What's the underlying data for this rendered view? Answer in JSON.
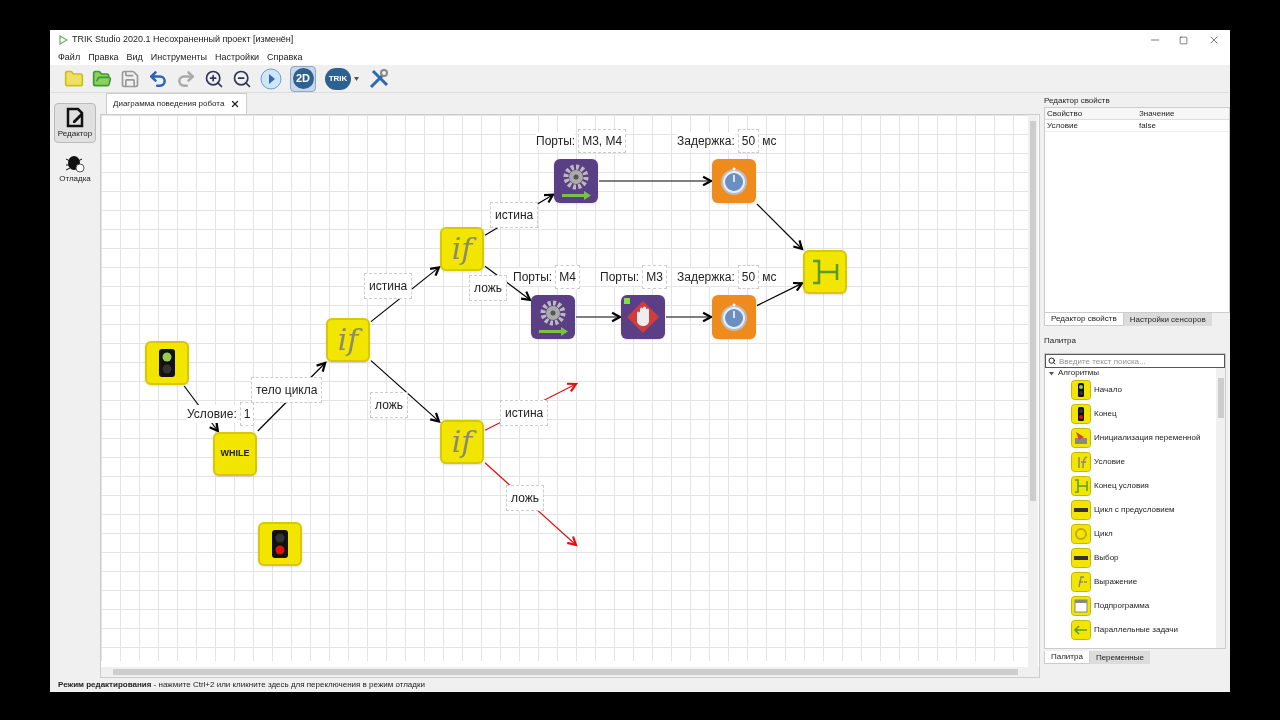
{
  "window": {
    "title": "TRIK Studio 2020.1 Несохраненный проект [изменён]"
  },
  "menu": [
    "Файл",
    "Правка",
    "Вид",
    "Инструменты",
    "Настройки",
    "Справка"
  ],
  "toolbar": [
    {
      "kind": "new"
    },
    {
      "kind": "open"
    },
    {
      "kind": "save"
    },
    {
      "kind": "undo"
    },
    {
      "kind": "redo"
    },
    {
      "kind": "zoom-in"
    },
    {
      "kind": "zoom-out"
    },
    {
      "kind": "run"
    },
    {
      "kind": "model",
      "label": "2D",
      "selected": true
    },
    {
      "kind": "robot",
      "label": "TRIK",
      "selected": false
    },
    {
      "kind": "tools"
    }
  ],
  "modes": [
    {
      "label": "Редактор",
      "kind": "editor",
      "selected": true
    },
    {
      "label": "Отладка",
      "kind": "debug",
      "selected": false
    }
  ],
  "document_tab": {
    "label": "Диаграмма поведения робота"
  },
  "diagram": {
    "nodes": [
      {
        "kind": "start"
      },
      {
        "kind": "while",
        "text": "WHILE",
        "param_label": "Условие:",
        "param_value": "1"
      },
      {
        "kind": "if",
        "text": "if"
      },
      {
        "kind": "if",
        "text": "if"
      },
      {
        "kind": "if",
        "text": "if"
      },
      {
        "kind": "motor",
        "param_label": "Порты:",
        "param_value": "M3, M4"
      },
      {
        "kind": "timer",
        "param_label": "Задержка:",
        "param_value": "50",
        "unit": "мс"
      },
      {
        "kind": "motor",
        "param_label": "Порты:",
        "param_value": "M4"
      },
      {
        "kind": "stop",
        "param_label": "Порты:",
        "param_value": "M3"
      },
      {
        "kind": "timer",
        "param_label": "Задержка:",
        "param_value": "50",
        "unit": "мс"
      },
      {
        "kind": "endif"
      },
      {
        "kind": "end"
      }
    ],
    "edges": [
      {
        "kind": "link"
      },
      {
        "kind": "link",
        "label": "тело цикла"
      },
      {
        "kind": "link",
        "label": "истина"
      },
      {
        "kind": "link",
        "label": "ложь"
      },
      {
        "kind": "link",
        "label": "истина"
      },
      {
        "kind": "link",
        "label": "ложь"
      },
      {
        "kind": "link"
      },
      {
        "kind": "link"
      },
      {
        "kind": "link"
      },
      {
        "kind": "link"
      },
      {
        "kind": "link"
      },
      {
        "kind": "unconnected",
        "label": "истина"
      },
      {
        "kind": "unconnected",
        "label": "ложь"
      }
    ]
  },
  "properties": {
    "title": "Редактор свойств",
    "columns": [
      "Свойство",
      "Значение"
    ],
    "rows": [
      {
        "property": "Условие",
        "value": "false"
      }
    ],
    "tabs": [
      {
        "label": "Редактор свойств",
        "selected": true
      },
      {
        "label": "Настройки сенсоров",
        "selected": false
      }
    ]
  },
  "palette": {
    "title": "Палитра",
    "search": {
      "placeholder": "Введите текст поиска..."
    },
    "group": {
      "label": "Алгоритмы",
      "expanded": true,
      "items": [
        {
          "kind": "start",
          "label": "Начало"
        },
        {
          "kind": "end",
          "label": "Конец"
        },
        {
          "kind": "var",
          "label": "Инициализация переменной"
        },
        {
          "kind": "if",
          "label": "Условие"
        },
        {
          "kind": "endif",
          "label": "Конец условия"
        },
        {
          "kind": "while",
          "label": "Цикл с предусловием"
        },
        {
          "kind": "loop",
          "label": "Цикл"
        },
        {
          "kind": "switch",
          "label": "Выбор"
        },
        {
          "kind": "expr",
          "label": "Выражение"
        },
        {
          "kind": "sub",
          "label": "Подпрограмма"
        },
        {
          "kind": "fork",
          "label": "Параллельные задачи"
        }
      ]
    },
    "tabs": [
      {
        "label": "Палитра",
        "selected": true
      },
      {
        "label": "Переменные",
        "selected": false
      }
    ]
  },
  "status_bar": {
    "text": "**Режим редактирования** - нажмите Ctrl+2 или кликните здесь для переключения в режим отладки"
  }
}
